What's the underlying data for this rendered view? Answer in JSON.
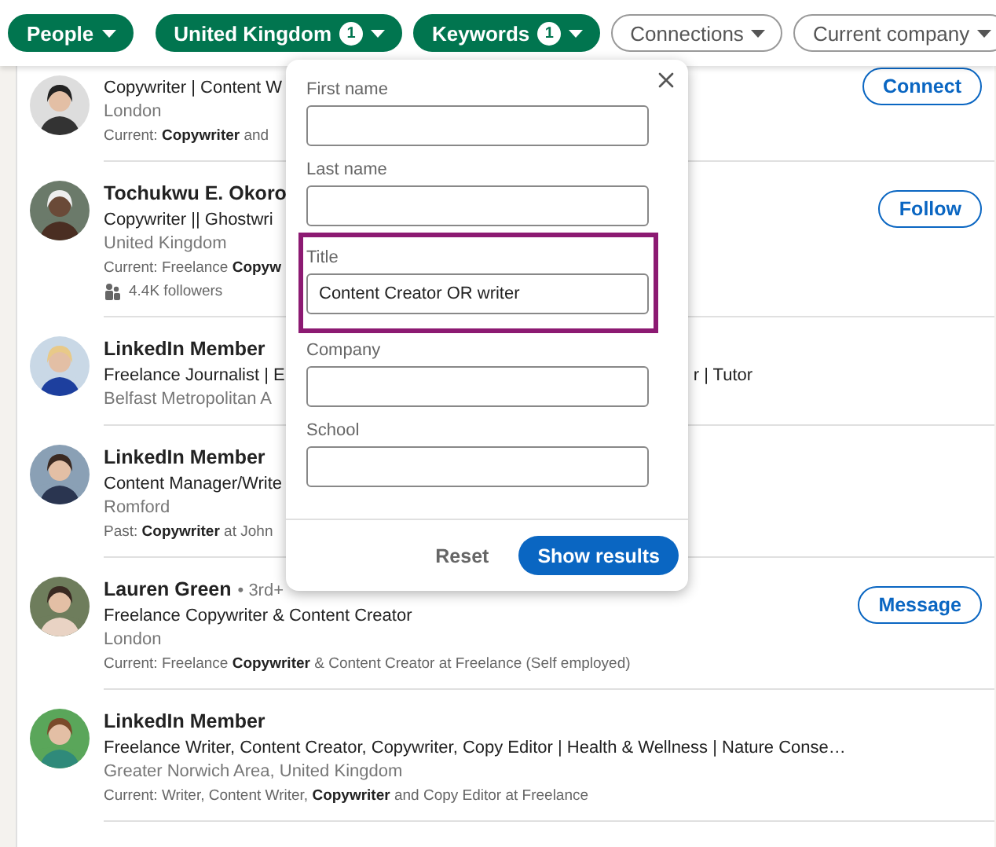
{
  "filters": [
    {
      "label": "People",
      "selected": true
    },
    {
      "label": "United Kingdom",
      "count": "1",
      "selected": true
    },
    {
      "label": "Keywords",
      "count": "1",
      "selected": true
    },
    {
      "label": "Connections",
      "selected": false
    },
    {
      "label": "Current company",
      "selected": false
    }
  ],
  "results": [
    {
      "headline": "Copywriter | Content W",
      "location": "London",
      "current": "Current: **Copywriter** and",
      "action": "Connect"
    },
    {
      "name": "Tochukwu E. Okoro",
      "headline": "Copywriter || Ghostwri",
      "location": "United Kingdom",
      "current": "Current: Freelance **Copyw**",
      "followers": "4.4K followers",
      "action": "Follow"
    },
    {
      "name": "LinkedIn Member",
      "headline": "Freelance Journalist | E",
      "headline_tail": "r | Tutor",
      "location": "Belfast Metropolitan A"
    },
    {
      "name": "LinkedIn Member",
      "headline": "Content Manager/Write",
      "location": "Romford",
      "current": "Past: **Copywriter** at John"
    },
    {
      "name": "Lauren Green",
      "degree": "• 3rd+",
      "headline": "Freelance Copywriter & Content Creator",
      "location": "London",
      "current": "Current: Freelance **Copywriter** & Content Creator at Freelance (Self employed)",
      "action": "Message"
    },
    {
      "name": "LinkedIn Member",
      "headline": "Freelance Writer, Content Creator, Copywriter, Copy Editor | Health & Wellness | Nature Conse…",
      "location": "Greater Norwich Area, United Kingdom",
      "current": "Current: Writer, Content Writer, **Copywriter** and Copy Editor at Freelance"
    }
  ],
  "keywords_panel": {
    "fields": [
      {
        "label": "First name",
        "highlighted": false
      },
      {
        "label": "Last name",
        "highlighted": false
      },
      {
        "label": "Title",
        "value": "Content Creator OR writer",
        "highlighted": true
      },
      {
        "label": "Company",
        "highlighted": false
      },
      {
        "label": "School",
        "highlighted": false
      }
    ],
    "reset": "Reset",
    "show_results": "Show results"
  }
}
